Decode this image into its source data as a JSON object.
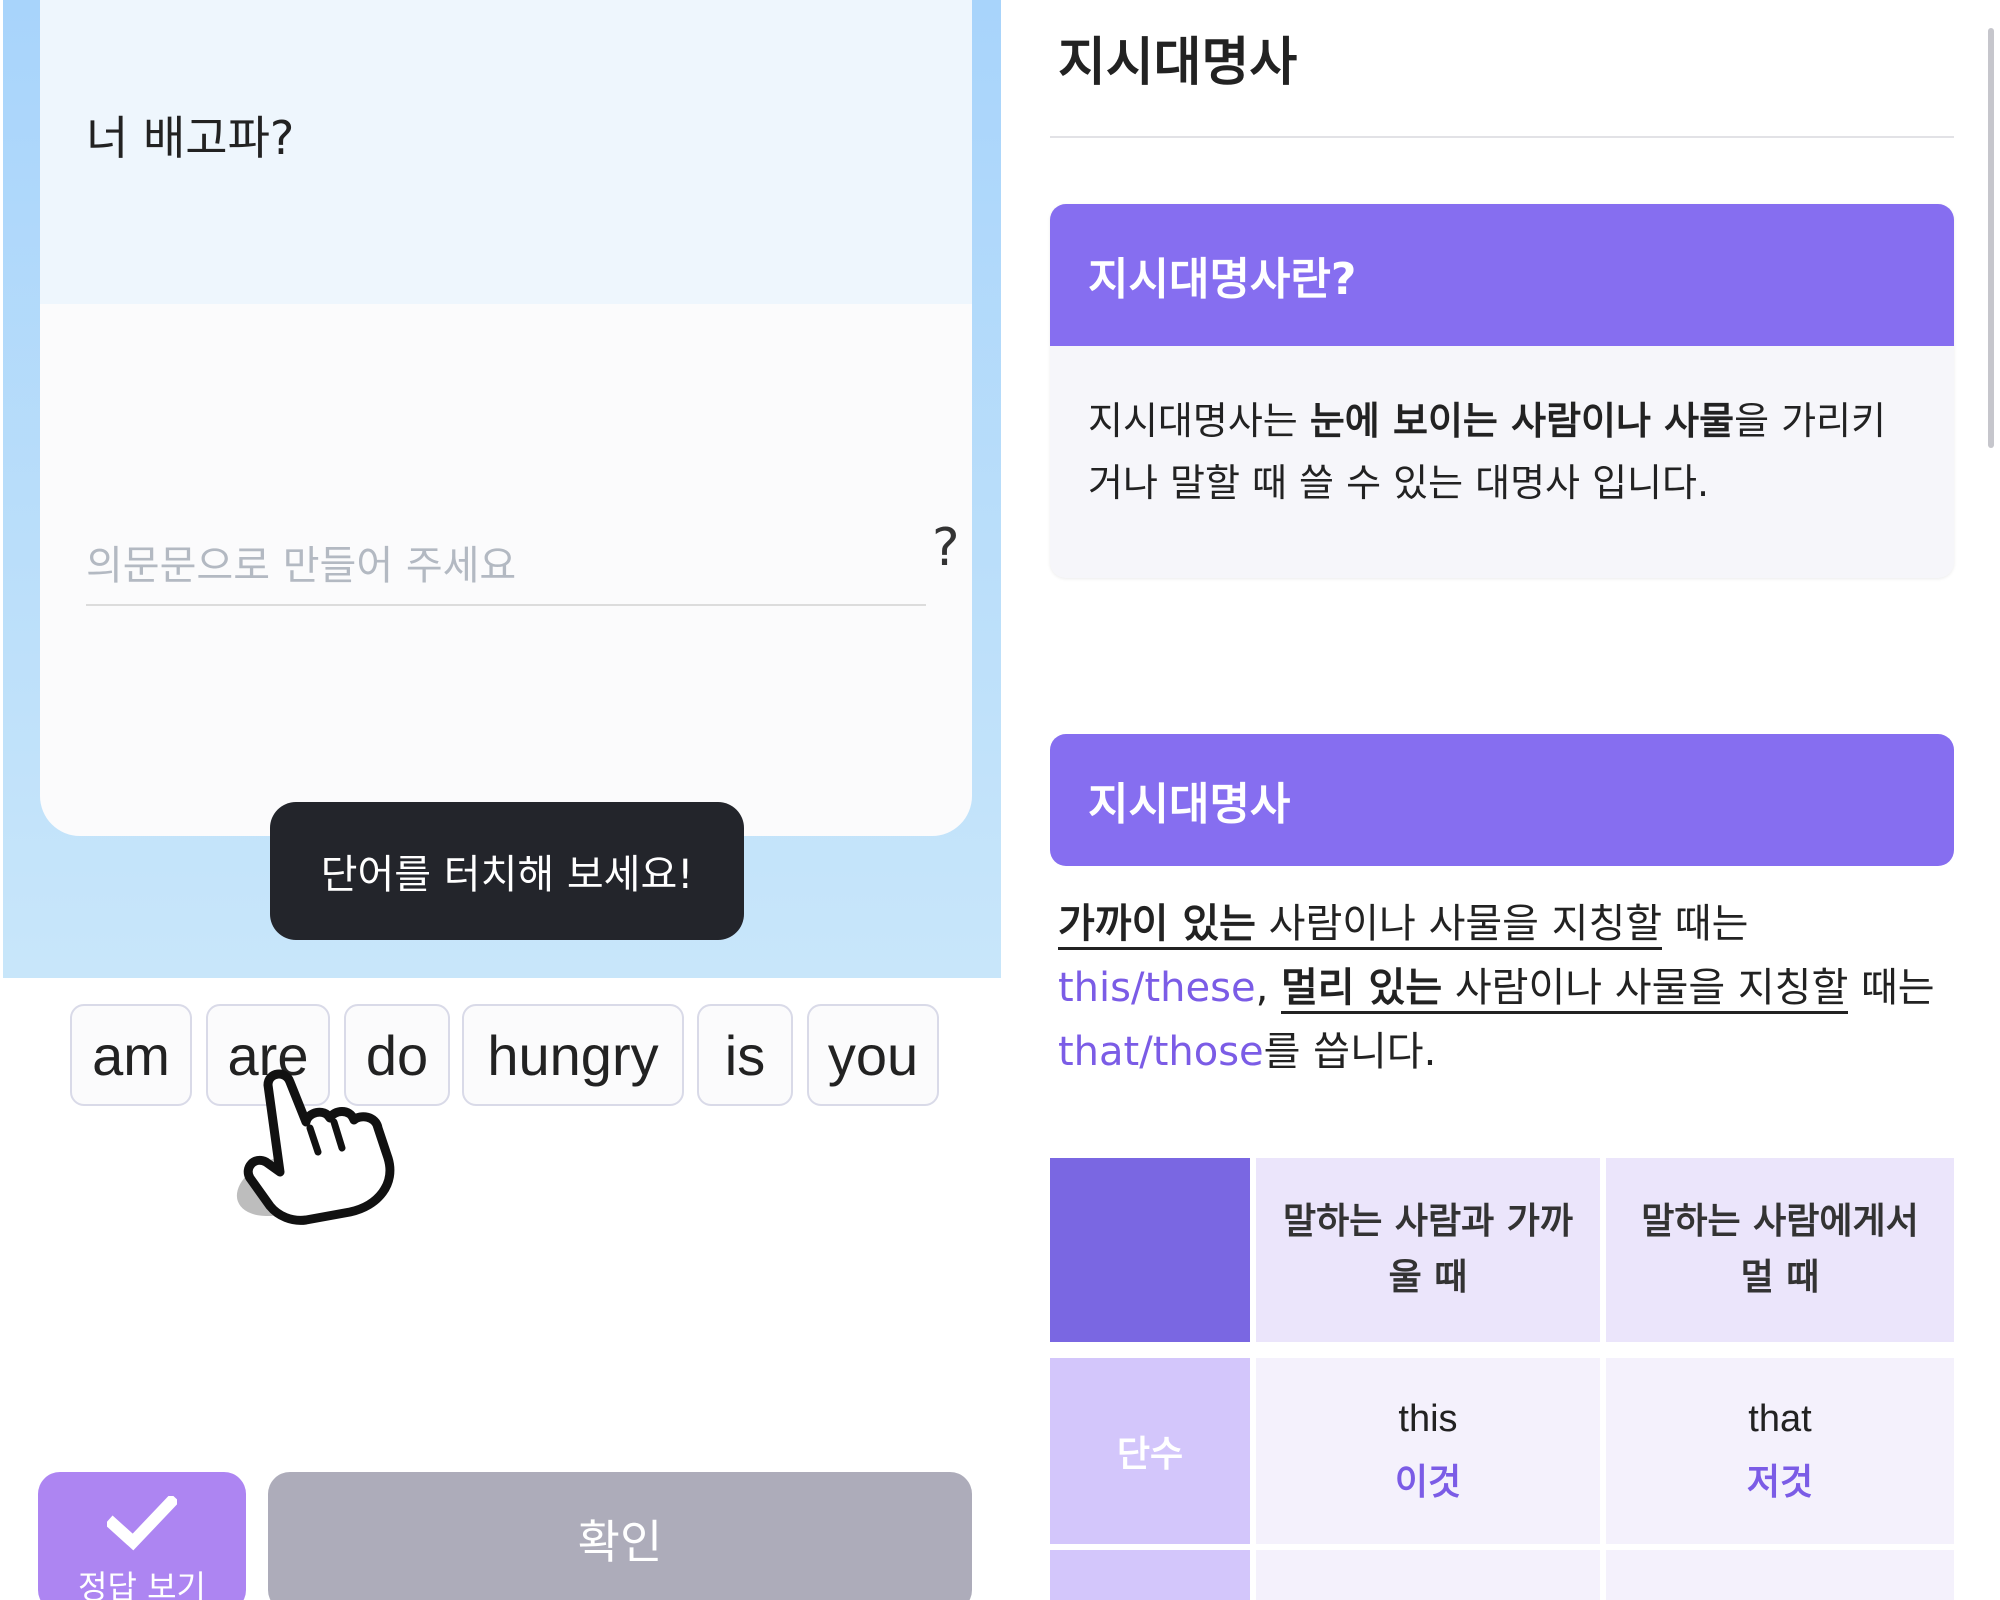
{
  "quiz": {
    "question": "너 배고파?",
    "answer_placeholder": "의문문으로 만들어 주세요",
    "answer_value": "",
    "end_mark": "?",
    "toast": "단어를 터치해 보세요!",
    "words": [
      "am",
      "are",
      "do",
      "hungry",
      "is",
      "you"
    ],
    "show_answer_label": "정답 보기",
    "confirm_label": "확인"
  },
  "lesson": {
    "title": "지시대명사",
    "intro": {
      "heading": "지시대명사란?",
      "body_prefix": "지시대명사는 ",
      "body_bold": "눈에 보이는 사람이나 사물",
      "body_suffix": "을 가리키거나 말할 때 쓸 수 있는 대명사 입니다."
    },
    "section": {
      "heading": "지시대명사",
      "near_bold": "가까이 있는",
      "near_rest": " 사람이나 사물을 지칭할",
      "near_tail": " 때는 ",
      "near_words": "this/these",
      "comma": ", ",
      "far_bold": "멀리 있는",
      "far_rest": " 사람이나 사물을 지칭할",
      "far_tail": " 때는 ",
      "far_words": "that/those",
      "ending": "를 씁니다."
    },
    "table": {
      "col_near": "말하는 사람과 가까울 때",
      "col_far": "말하는 사람에게서 멀 때",
      "rows": [
        {
          "label": "단수",
          "near_en": "this",
          "near_ko": "이것",
          "far_en": "that",
          "far_ko": "저것"
        }
      ]
    }
  },
  "colors": {
    "accent_purple": "#866ef0",
    "highlight_text": "#7b5ce6",
    "toast_bg": "#23252b",
    "answer_btn": "#ad85f2",
    "confirm_btn": "#adacba"
  },
  "icons": [
    "pointing-hand-icon",
    "checkmark-icon"
  ]
}
